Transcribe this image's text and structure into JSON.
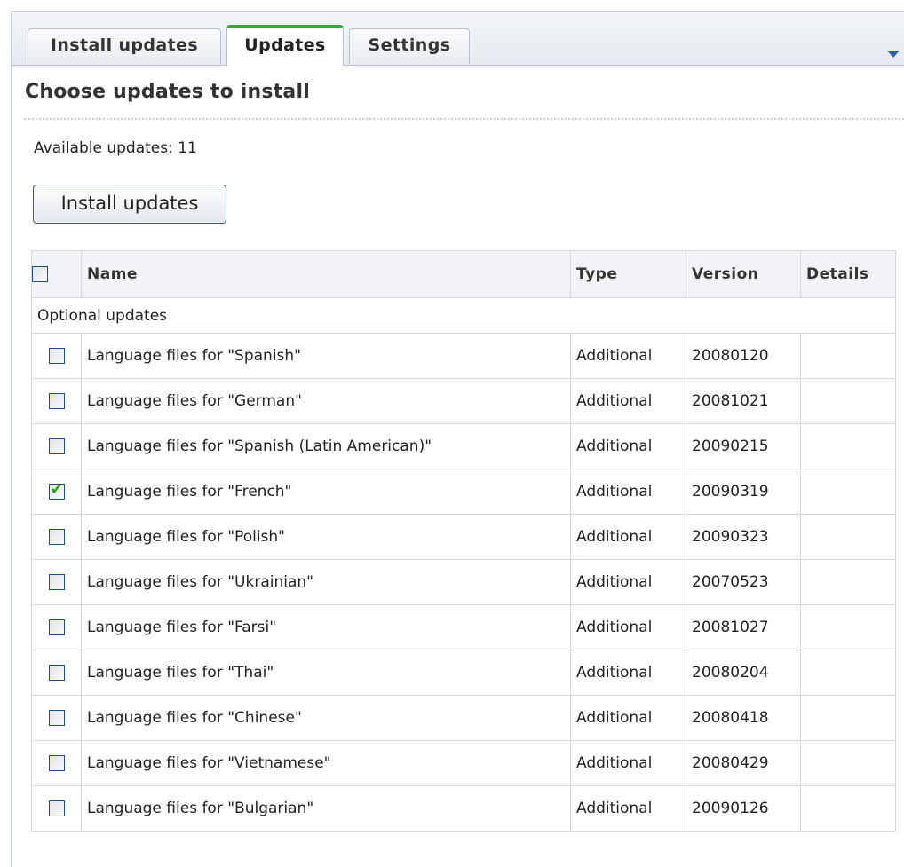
{
  "tabs": [
    {
      "label": "Install updates",
      "active": false
    },
    {
      "label": "Updates",
      "active": true
    },
    {
      "label": "Settings",
      "active": false
    }
  ],
  "header": {
    "title": "Choose updates to install",
    "available": "Available updates: 11"
  },
  "toolbar": {
    "install_label": "Install updates"
  },
  "table": {
    "columns": {
      "name": "Name",
      "type": "Type",
      "version": "Version",
      "details": "Details"
    },
    "group_label": "Optional updates",
    "rows": [
      {
        "name": "Language files for \"Spanish\"",
        "type": "Additional",
        "version": "20080120",
        "details": "",
        "checked": false
      },
      {
        "name": "Language files for \"German\"",
        "type": "Additional",
        "version": "20081021",
        "details": "",
        "checked": false
      },
      {
        "name": "Language files for \"Spanish (Latin American)\"",
        "type": "Additional",
        "version": "20090215",
        "details": "",
        "checked": false
      },
      {
        "name": "Language files for \"French\"",
        "type": "Additional",
        "version": "20090319",
        "details": "",
        "checked": true
      },
      {
        "name": "Language files for \"Polish\"",
        "type": "Additional",
        "version": "20090323",
        "details": "",
        "checked": false
      },
      {
        "name": "Language files for \"Ukrainian\"",
        "type": "Additional",
        "version": "20070523",
        "details": "",
        "checked": false
      },
      {
        "name": "Language files for \"Farsi\"",
        "type": "Additional",
        "version": "20081027",
        "details": "",
        "checked": false
      },
      {
        "name": "Language files for \"Thai\"",
        "type": "Additional",
        "version": "20080204",
        "details": "",
        "checked": false
      },
      {
        "name": "Language files for \"Chinese\"",
        "type": "Additional",
        "version": "20080418",
        "details": "",
        "checked": false
      },
      {
        "name": "Language files for \"Vietnamese\"",
        "type": "Additional",
        "version": "20080429",
        "details": "",
        "checked": false
      },
      {
        "name": "Language files for \"Bulgarian\"",
        "type": "Additional",
        "version": "20090126",
        "details": "",
        "checked": false
      }
    ]
  },
  "colors": {
    "accent_tab": "#3aa640",
    "checkmark": "#21a121",
    "link_arrow": "#2f5fb0"
  }
}
